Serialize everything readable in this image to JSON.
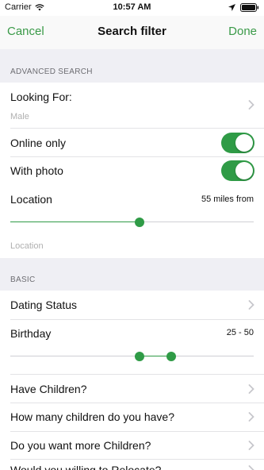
{
  "status_bar": {
    "carrier": "Carrier",
    "time": "10:57 AM"
  },
  "nav": {
    "cancel_label": "Cancel",
    "title": "Search filter",
    "done_label": "Done"
  },
  "advanced": {
    "header": "ADVANCED SEARCH",
    "looking_for": {
      "label": "Looking For:",
      "value": "Male"
    },
    "online_only": {
      "label": "Online only",
      "on": true
    },
    "with_photo": {
      "label": "With photo",
      "on": true
    },
    "location": {
      "label": "Location",
      "value": "55 miles from",
      "placeholder": "Location",
      "slider_fraction": 0.53
    }
  },
  "basic": {
    "header": "BASIC",
    "dating_status": {
      "label": "Dating Status"
    },
    "birthday": {
      "label": "Birthday",
      "value": "25 - 50",
      "range_low_fraction": 0.53,
      "range_high_fraction": 0.66
    },
    "have_children": {
      "label": "Have Children?"
    },
    "how_many_children": {
      "label": "How many children do you have?"
    },
    "want_more_children": {
      "label": "Do you want more Children?"
    },
    "willing_to_relocate": {
      "label": "Would you willing to Relocate?"
    }
  },
  "colors": {
    "accent": "#3a9a48",
    "section_bg": "#efeff4",
    "muted_text": "#b0b0b0"
  }
}
